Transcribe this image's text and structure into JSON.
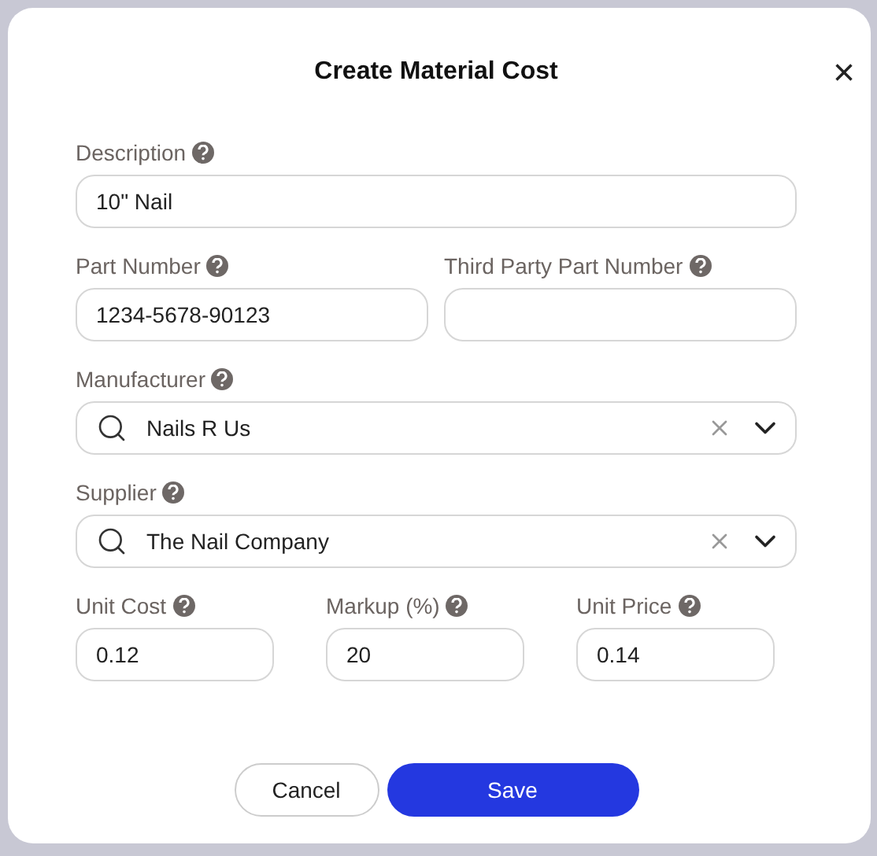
{
  "dialog": {
    "title": "Create Material Cost",
    "close": "×"
  },
  "rows": [
    {
      "fields": [
        {
          "kind": "text",
          "label": "Description",
          "value": "10\" Nail"
        }
      ]
    },
    {
      "fields": [
        {
          "kind": "text",
          "label": "Part Number",
          "value": "1234-5678-90123"
        },
        {
          "kind": "text",
          "label": "Third Party Part Number"
        }
      ]
    },
    {
      "fields": [
        {
          "kind": "search",
          "label": "Manufacturer",
          "value": "Nails R Us"
        }
      ]
    },
    {
      "fields": [
        {
          "kind": "search",
          "label": "Supplier",
          "value": "The Nail Company"
        }
      ]
    },
    {
      "fields": [
        {
          "kind": "text",
          "label": "Unit Cost",
          "value": "0.12"
        },
        {
          "kind": "text",
          "label": "Markup (%)",
          "value": "20"
        },
        {
          "kind": "text",
          "label": "Unit Price",
          "value": "0.14"
        }
      ]
    }
  ],
  "buttons": [
    {
      "kind": "secondary",
      "label": "Cancel"
    },
    {
      "kind": "primary",
      "label": "Save"
    }
  ]
}
